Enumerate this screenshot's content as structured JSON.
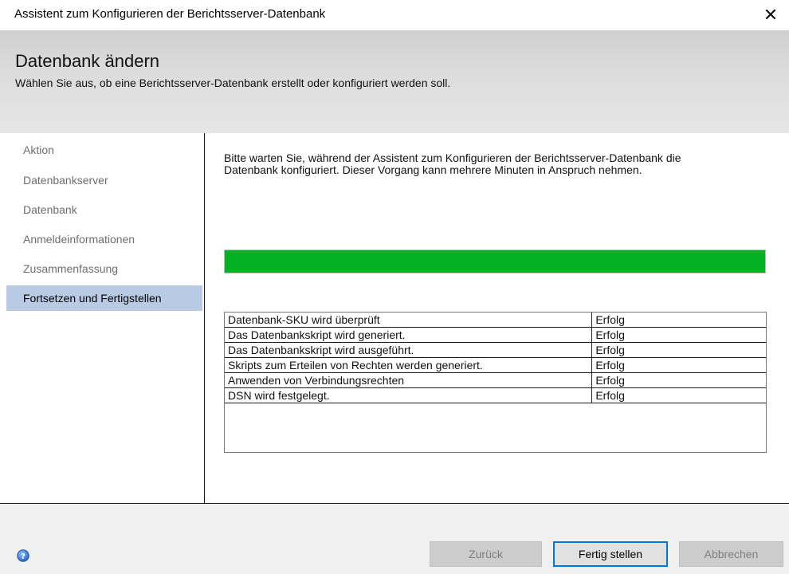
{
  "window": {
    "title": "Assistent zum Konfigurieren der Berichtsserver-Datenbank",
    "close_glyph": "✕"
  },
  "header": {
    "title": "Datenbank ändern",
    "subtitle": "Wählen Sie aus, ob eine Berichtsserver-Datenbank erstellt oder konfiguriert werden soll."
  },
  "sidebar": {
    "items": [
      {
        "label": "Aktion"
      },
      {
        "label": "Datenbankserver"
      },
      {
        "label": "Datenbank"
      },
      {
        "label": "Anmeldeinformationen"
      },
      {
        "label": "Zusammenfassung"
      },
      {
        "label": "Fortsetzen und Fertigstellen"
      }
    ],
    "active_index": 5
  },
  "main": {
    "description": "Bitte warten Sie, während der Assistent zum Konfigurieren der Berichtsserver-Datenbank die Datenbank konfiguriert. Dieser Vorgang kann mehrere Minuten in Anspruch nehmen.",
    "progress": {
      "percent": 100,
      "color": "#06b025"
    },
    "tasks": [
      {
        "task": "Datenbank-SKU wird überprüft",
        "status": "Erfolg"
      },
      {
        "task": "Das Datenbankskript wird generiert.",
        "status": "Erfolg"
      },
      {
        "task": "Das Datenbankskript wird ausgeführt.",
        "status": "Erfolg"
      },
      {
        "task": "Skripts zum Erteilen von Rechten werden generiert.",
        "status": "Erfolg"
      },
      {
        "task": "Anwenden von Verbindungsrechten",
        "status": "Erfolg"
      },
      {
        "task": "DSN wird festgelegt.",
        "status": "Erfolg"
      }
    ]
  },
  "footer": {
    "help_icon": "help-icon",
    "back_label": "Zurück",
    "finish_label": "Fertig stellen",
    "cancel_label": "Abbrechen"
  },
  "colors": {
    "accent": "#0078d7",
    "selection": "#b9cbe4",
    "progress": "#06b025"
  }
}
